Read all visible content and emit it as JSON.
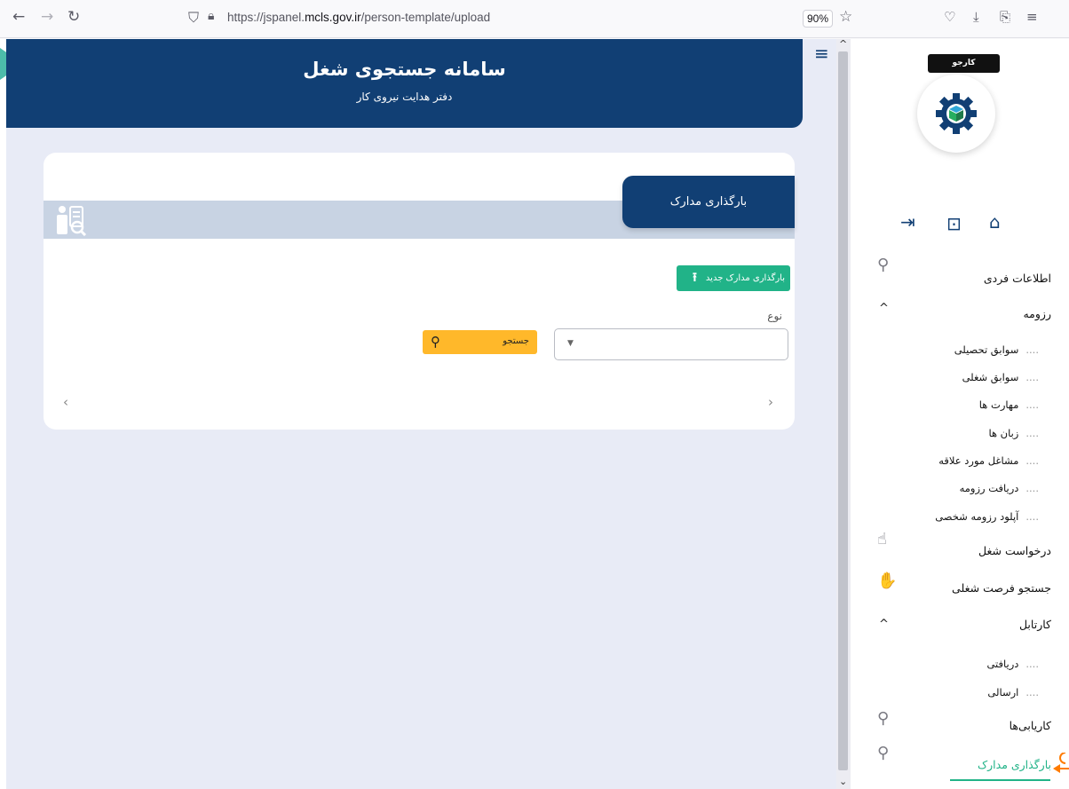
{
  "browser": {
    "url_prefix": "https://jspanel.",
    "url_domain": "mcls.gov.ir",
    "url_path": "/person-template/upload",
    "zoom": "90%"
  },
  "header": {
    "title": "سامانه جستجوی شغل",
    "subtitle": "دفتر هدایت نیروی کار"
  },
  "card": {
    "tab_title": "بارگذاری مدارک",
    "upload_button": "بارگذاری مدارک جدید",
    "type_label": "نوع",
    "search_button": "جستجو"
  },
  "sidebar": {
    "brand": "کارجو",
    "items": {
      "personal_info": "اطلاعات فردی",
      "resume": "رزومه",
      "job_request": "درخواست شغل",
      "job_search": "جستجو فرصت شغلی",
      "cartable": "کارتابل",
      "employment": "کاریابی‌ها",
      "upload_docs": "بارگذاری مدارک"
    },
    "resume_sub": [
      "سوابق تحصیلی",
      "سوابق شغلی",
      "مهارت ها",
      "زبان ها",
      "مشاغل مورد علاقه",
      "دریافت رزومه",
      "آپلود رزومه شخصی"
    ],
    "cartable_sub": [
      "دریافتی",
      "ارسالی"
    ]
  },
  "colors": {
    "primary": "#113f74",
    "accent": "#21b388",
    "search": "#ffb82a",
    "highlight_arrow": "#ff7b00"
  }
}
